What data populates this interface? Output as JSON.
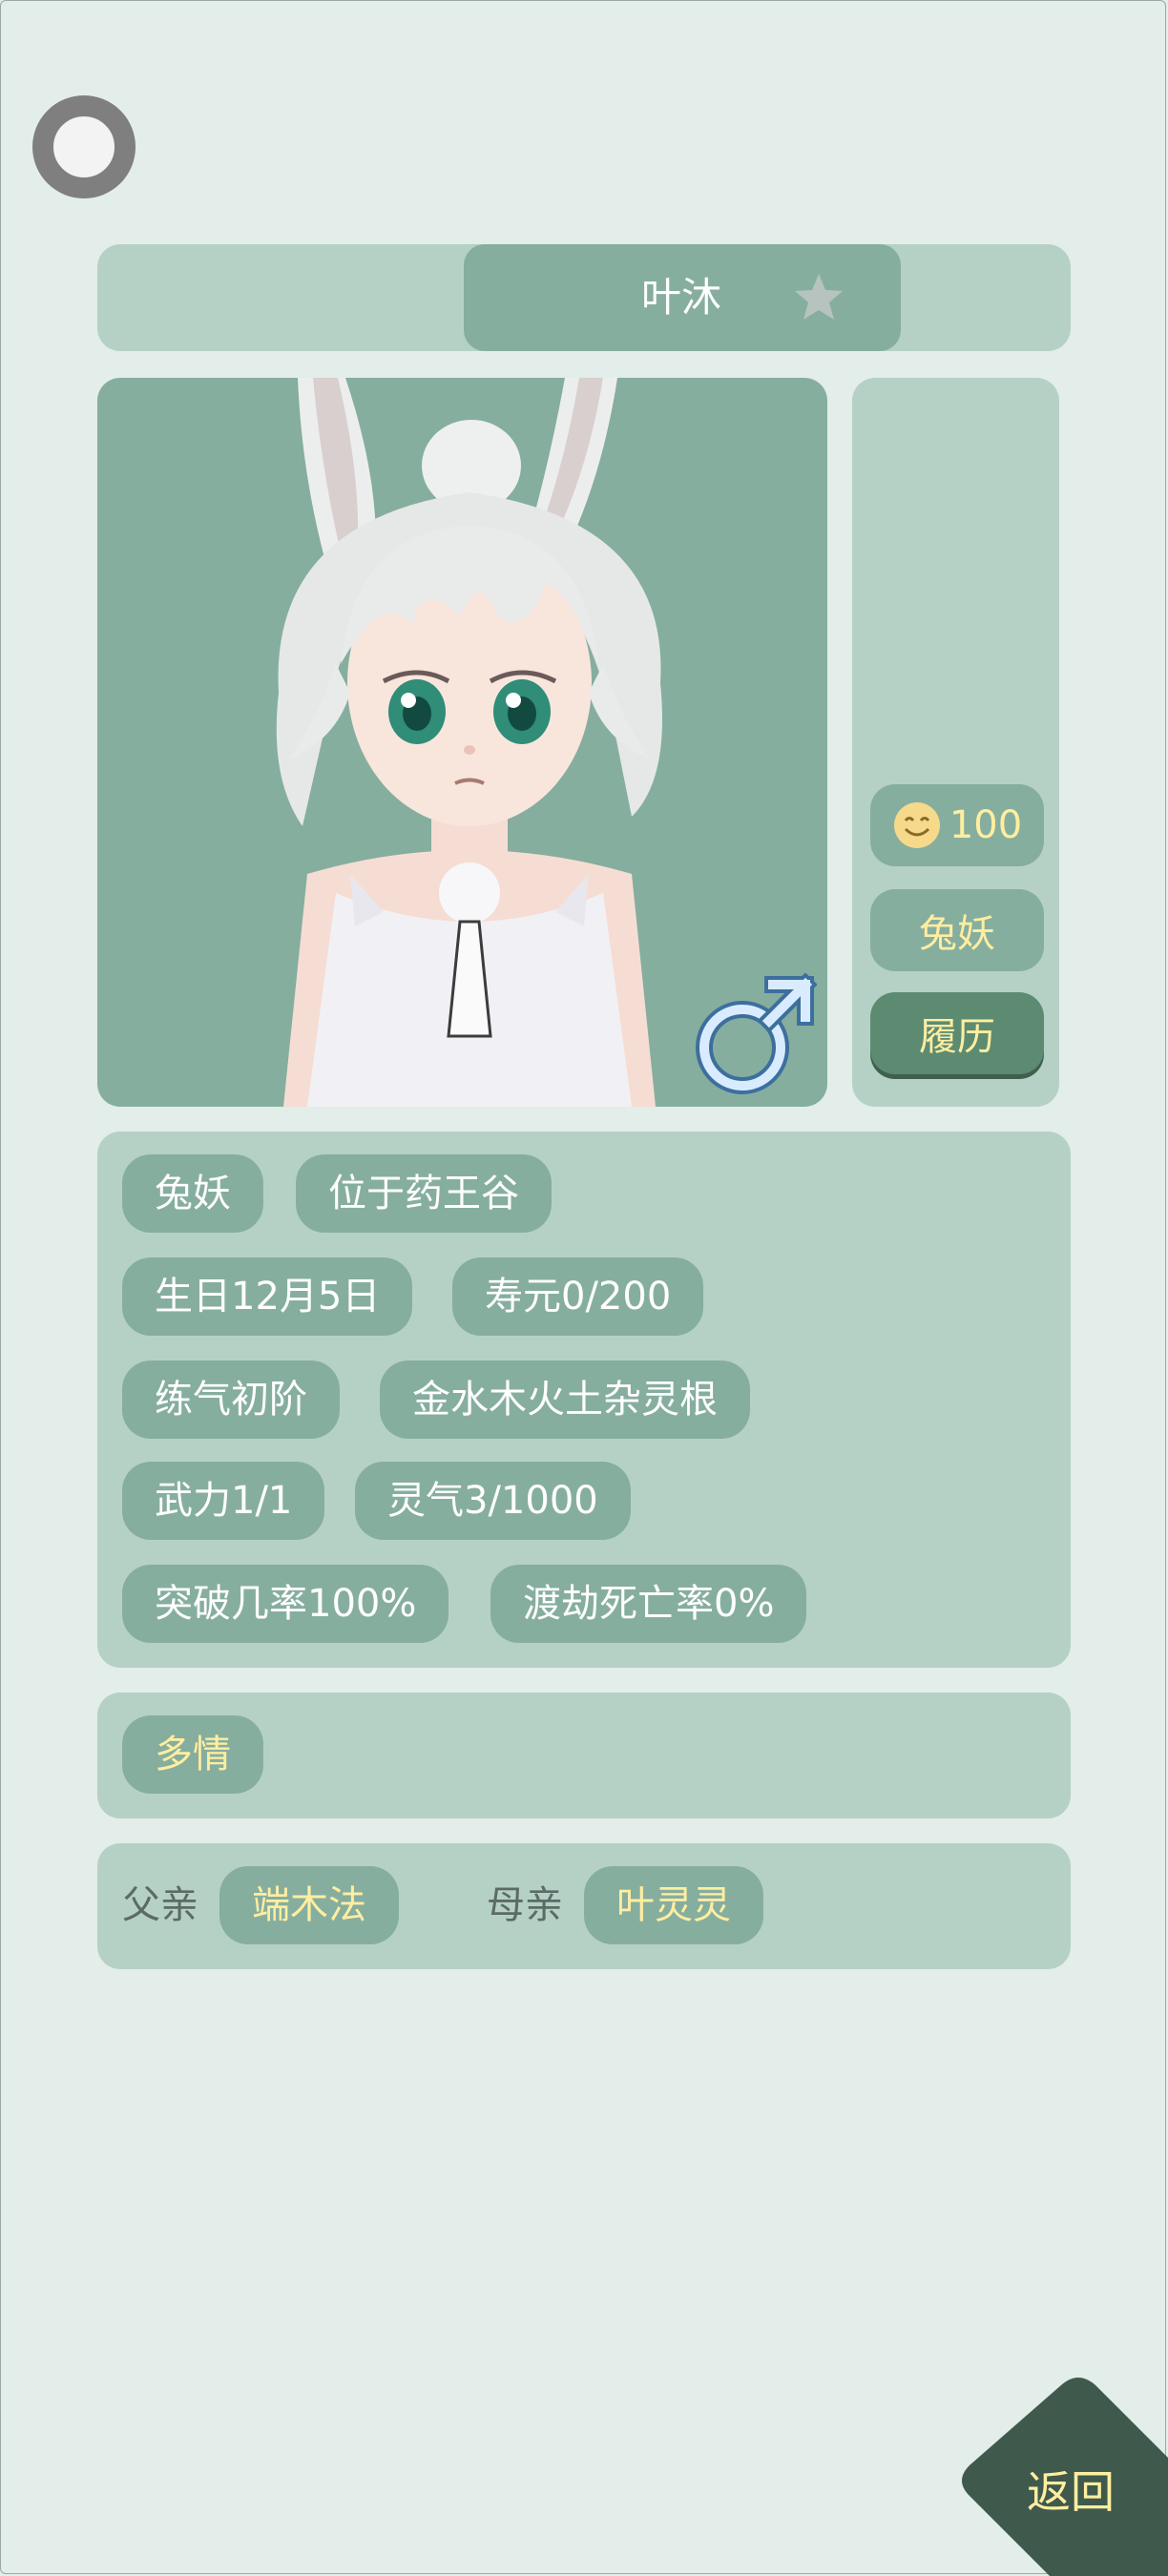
{
  "character": {
    "name": "叶沐",
    "mood_value": "100",
    "race_button": "兔妖",
    "history_button": "履历"
  },
  "info_tags": [
    "兔妖",
    "位于药王谷",
    "生日12月5日",
    "寿元0/200",
    "练气初阶",
    "金水木火土杂灵根",
    "武力1/1",
    "灵气3/1000",
    "突破几率100%",
    "渡劫死亡率0%"
  ],
  "traits": [
    "多情"
  ],
  "family": {
    "father_label": "父亲",
    "father_name": "端木法",
    "mother_label": "母亲",
    "mother_name": "叶灵灵"
  },
  "back_button": "返回",
  "colors": {
    "background": "#e3ede9",
    "panel": "#b5d1c6",
    "tag": "#86ae9f",
    "accent_text": "#ffeea0",
    "back_button": "#3f5a4c"
  },
  "icons": {
    "ring": "circle-ring-icon",
    "favorite": "star-icon",
    "gender": "male-icon",
    "mood": "smile-icon"
  }
}
